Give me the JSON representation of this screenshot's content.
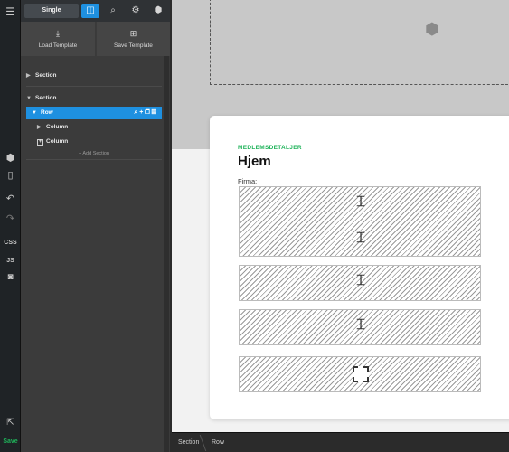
{
  "rail": {
    "menu_icon": "menu-icon",
    "items": [
      {
        "name": "components-icon",
        "glyph": "⬢"
      },
      {
        "name": "mobile-icon",
        "glyph": "▯"
      },
      {
        "name": "undo-icon",
        "glyph": "↶"
      },
      {
        "name": "redo-icon",
        "glyph": "↷"
      }
    ],
    "css_label": "CSS",
    "js_label": "JS",
    "save_label": "Save"
  },
  "topbar": {
    "mode_label": "Single"
  },
  "templates": {
    "load_label": "Load Template",
    "save_label": "Save Template"
  },
  "tree": {
    "section1_label": "Section",
    "section2_label": "Section",
    "row_label": "Row",
    "column1_label": "Column",
    "column2_label": "Column",
    "add_section_label": "+ Add Section"
  },
  "card": {
    "eyebrow": "MEDLEMSDETALJER",
    "heading": "Hjem",
    "field_label": "Firma:"
  },
  "breadcrumbs": [
    "Section",
    "Row"
  ],
  "colors": {
    "accent": "#1e90e0",
    "save": "#1fb35a",
    "eyebrow": "#1fb35a"
  }
}
